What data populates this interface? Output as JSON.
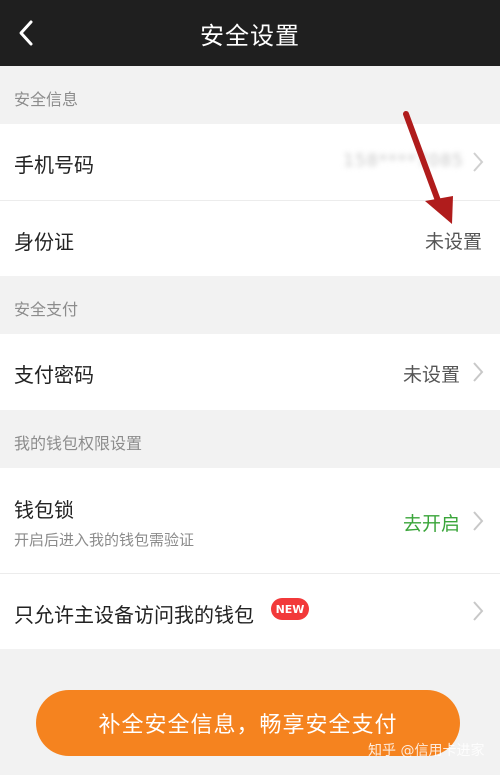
{
  "header": {
    "title": "安全设置",
    "back_icon": "chevron-left-icon"
  },
  "sections": {
    "security_info": "安全信息",
    "security_payment": "安全支付",
    "wallet_permissions": "我的钱包权限设置"
  },
  "rows": {
    "phone": {
      "title": "手机号码",
      "value": "158****7085"
    },
    "id_card": {
      "title": "身份证",
      "value": "未设置"
    },
    "pay_password": {
      "title": "支付密码",
      "value": "未设置"
    },
    "wallet_lock": {
      "title": "钱包锁",
      "subtitle": "开启后进入我的钱包需验证",
      "value": "去开启"
    },
    "main_device": {
      "title": "只允许主设备访问我的钱包",
      "badge": "NEW"
    }
  },
  "cta": {
    "label": "补全安全信息，畅享安全支付"
  },
  "watermark": "知乎 @信用卡进家",
  "colors": {
    "header_bg": "#1f1f1f",
    "accent_orange": "#f5831f",
    "badge_red": "#f2393a",
    "green_link": "#3aa53a",
    "annotation_arrow": "#b01c1c"
  }
}
